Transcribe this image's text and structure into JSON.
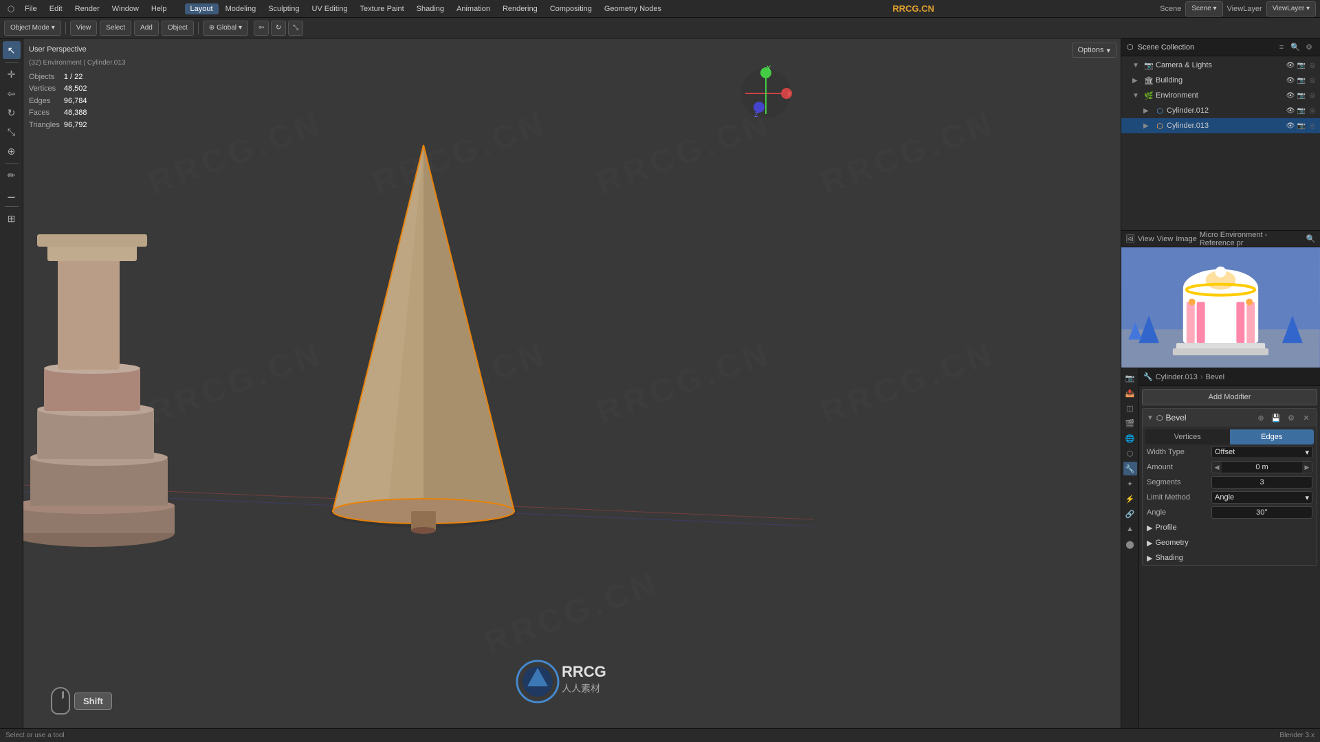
{
  "app": {
    "title": "RRCG.CN",
    "editor_type": "Scene"
  },
  "top_menu": {
    "items": [
      "File",
      "Edit",
      "Render",
      "Window",
      "Help"
    ],
    "workspace_tabs": [
      "Layout",
      "Modeling",
      "Sculpting",
      "UV Editing",
      "Texture Paint",
      "Shading",
      "Animation",
      "Rendering",
      "Compositing",
      "Geometry Nodes"
    ]
  },
  "toolbar": {
    "mode": "Object Mode",
    "view": "View",
    "select": "Select",
    "add": "Add",
    "object": "Object",
    "transform_global": "Global",
    "options_label": "Options"
  },
  "viewport": {
    "title": "User Perspective",
    "subtitle": "(32) Environment | Cylinder.013",
    "stats": {
      "objects_label": "Objects",
      "objects_val": "1 / 22",
      "vertices_label": "Vertices",
      "vertices_val": "48,502",
      "edges_label": "Edges",
      "edges_val": "96,784",
      "faces_label": "Faces",
      "faces_val": "48,388",
      "triangles_label": "Triangles",
      "triangles_val": "96,792"
    }
  },
  "outliner": {
    "title": "Scene Collection",
    "items": [
      {
        "label": "Camera & Lights",
        "icon": "📷",
        "level": 1,
        "expanded": true
      },
      {
        "label": "Building",
        "icon": "🏛",
        "level": 1,
        "expanded": false
      },
      {
        "label": "Environment",
        "icon": "🌿",
        "level": 1,
        "expanded": true
      },
      {
        "label": "Cylinder.012",
        "icon": "⬡",
        "level": 2,
        "expanded": false
      },
      {
        "label": "Cylinder.013",
        "icon": "⬡",
        "level": 2,
        "expanded": false,
        "selected": true,
        "active": true
      }
    ]
  },
  "properties": {
    "breadcrumb": {
      "object": "Cylinder.013",
      "modifier": "Bevel"
    },
    "add_modifier_label": "Add Modifier",
    "bevel": {
      "title": "Bevel",
      "mode_tabs": [
        "Vertices",
        "Edges"
      ],
      "active_tab": "Edges",
      "width_type_label": "Width Type",
      "width_type_value": "Offset",
      "amount_label": "Amount",
      "amount_value": "0 m",
      "segments_label": "Segments",
      "segments_value": "3",
      "limit_method_label": "Limit Method",
      "limit_method_value": "Angle",
      "angle_label": "Angle",
      "angle_value": "30°",
      "sections": [
        "Profile",
        "Geometry",
        "Shading"
      ]
    }
  },
  "image_preview": {
    "label": "Micro Environment - Reference pr"
  },
  "shift_display": {
    "key_label": "Shift"
  },
  "rrcg": {
    "logo_text": "RRCG",
    "sub_text": "人人素材"
  }
}
